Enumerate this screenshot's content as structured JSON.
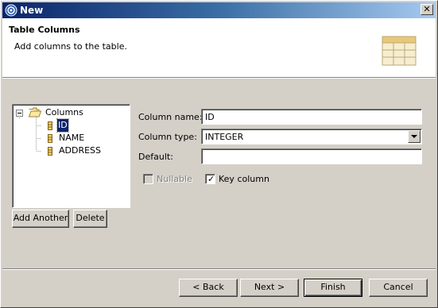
{
  "window": {
    "title": "New"
  },
  "banner": {
    "title": "Table Columns",
    "description": "Add columns to the table.",
    "image_icon": "table-icon"
  },
  "tree": {
    "root_label": "Columns",
    "items": [
      {
        "label": "ID",
        "selected": true
      },
      {
        "label": "NAME",
        "selected": false
      },
      {
        "label": "ADDRESS",
        "selected": false
      }
    ]
  },
  "tree_buttons": {
    "add_another": "Add Another",
    "delete": "Delete"
  },
  "form": {
    "column_name_label": "Column name:",
    "column_name_value": "ID",
    "column_type_label": "Column type:",
    "column_type_value": "INTEGER",
    "default_label": "Default:",
    "default_value": "",
    "nullable_label": "Nullable",
    "nullable_checked": false,
    "nullable_enabled": false,
    "key_column_label": "Key column",
    "key_column_checked": true
  },
  "footer": {
    "back": "< Back",
    "next": "Next >",
    "finish": "Finish",
    "cancel": "Cancel"
  },
  "colors": {
    "titlebar_start": "#0a246a",
    "titlebar_end": "#a6caf0",
    "dialog_bg": "#d4d0c8",
    "selection": "#0a246a"
  }
}
